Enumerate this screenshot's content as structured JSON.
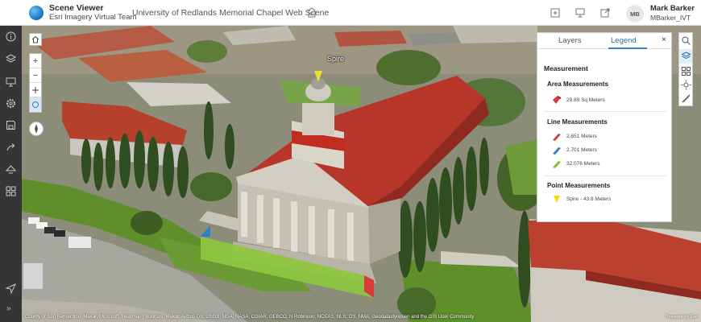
{
  "header": {
    "app_name": "Scene Viewer",
    "team_name": "Esri Imagery Virtual Team",
    "scene_title": "University of Redlands Memorial Chapel Web Scene",
    "user_initials": "MB",
    "user_name": "Mark Barker",
    "user_id": "MBarker_IVT"
  },
  "panel": {
    "tabs": [
      "Layers",
      "Legend"
    ],
    "active_tab": "Legend",
    "close_label": "×",
    "section_title": "Measurement",
    "area": {
      "title": "Area Measurements",
      "items": [
        {
          "label": "29.89 Sq Meters",
          "color": "#d73c3c"
        }
      ]
    },
    "line": {
      "title": "Line Measurements",
      "items": [
        {
          "label": "2.651 Meters",
          "color": "#d73c3c"
        },
        {
          "label": "2.701 Meters",
          "color": "#2c7fc9"
        },
        {
          "label": "32.076 Meters",
          "color": "#8bbd2c"
        }
      ]
    },
    "point": {
      "title": "Point Measurements",
      "items": [
        {
          "label": "Spire - 43.8 Meters",
          "color": "#f3e000"
        }
      ]
    }
  },
  "map": {
    "spire_label": "Spire",
    "attribution": "County of San Bernardino, Maxar, Microsoft, Nearmap | Sources: Maxar, Airbus DS, USGS, NGA, NASA, CGIAR, GEBCO, N Robinson, NCEAS, NLS, OS, NMA, Geodatastyrelsen and the GIS User Community",
    "powered_by": "Powered by Esri"
  },
  "icons": {
    "left_toolbar": [
      "info-icon",
      "layers-icon",
      "slides-icon",
      "settings-icon",
      "save-icon",
      "share-icon",
      "measure-icon",
      "basemap-icon"
    ],
    "right_strip": [
      "search-icon",
      "layers-legend-icon",
      "basemap-gallery-icon",
      "daylight-icon",
      "measure-tool-icon"
    ]
  }
}
